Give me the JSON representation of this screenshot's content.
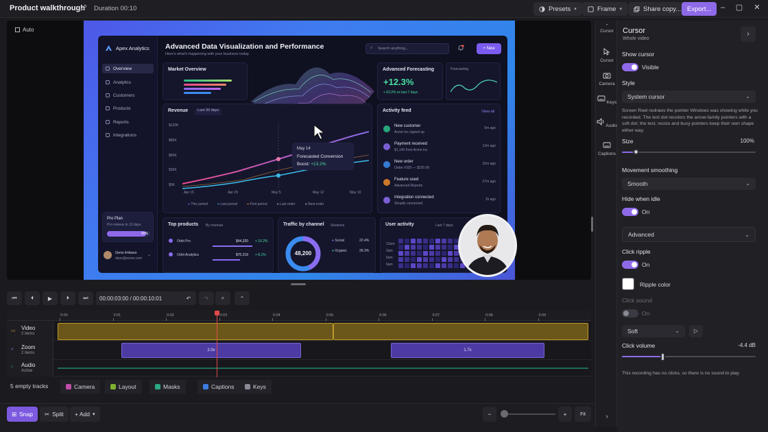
{
  "titlebar": {
    "title": "Product walkthrough",
    "duration": "Duration 00:10",
    "presets": "Presets",
    "frame": "Frame",
    "share": "Share copy...",
    "export": "Export..."
  },
  "preview": {
    "auto_label": "Auto",
    "app": {
      "brand": "Apex Analytics",
      "heading": "Advanced Data Visualization and Performance",
      "subheading": "Here's what's happening with your business today.",
      "search_placeholder": "Search anything...",
      "new_button": "+ New",
      "nav": [
        "Overview",
        "Analytics",
        "Customers",
        "Products",
        "Reports",
        "Integrations"
      ],
      "market_overview": "Market Overview",
      "forecast_title": "Advanced Forecasting",
      "forecast_value": "+12.3%",
      "forecast_sub": "+ 63.2% vs last 7 days",
      "forecasting_label": "Forecasting",
      "revenue_title": "Revenue",
      "revenue_range": "Last 30 days",
      "y_ticks": [
        "$120K",
        "$80K",
        "$60K",
        "$30K",
        "$0K"
      ],
      "x_ticks": [
        "Apr 15",
        "Apr 29",
        "May 5",
        "May 12",
        "May 10"
      ],
      "tooltip_date": "May 14",
      "tooltip_label": "Forecasted Conversion",
      "tooltip_boost_label": "Boost:",
      "tooltip_boost_value": "+13.2%",
      "legend": [
        "This period",
        "Last period",
        "First period",
        "Last order",
        "Next order"
      ],
      "activity_title": "Activity feed",
      "view_all": "View all",
      "activity": [
        {
          "title": "New customer",
          "sub": "Acme Inc signed up",
          "time": "5m ago",
          "color": "#2bbf8a"
        },
        {
          "title": "Payment received",
          "sub": "$1,140 from Acme Inc",
          "time": "12m ago",
          "color": "#8b6cf0"
        },
        {
          "title": "New order",
          "sub": "Order #320 — $220.00",
          "time": "15m ago",
          "color": "#3b8cf0"
        },
        {
          "title": "Feature used",
          "sub": "Advanced Reports",
          "time": "27m ago",
          "color": "#f08a2b"
        },
        {
          "title": "Integration connected",
          "sub": "Shopify connected",
          "time": "1h ago",
          "color": "#8b6cf0"
        }
      ],
      "pro_plan": "Pro Plan",
      "pro_sub": "Pro renews in 13 days",
      "pro_pct": "90%",
      "pro_fill": 0.9,
      "user_name": "Gera Imbaxs",
      "user_email": "dave@acme.com",
      "top_products": "Top products",
      "by_revenue": "By revenue",
      "products": [
        {
          "name": "Orbit Pro",
          "value": "$44,320",
          "delta": "+ 16.2%"
        },
        {
          "name": "Orbit Analytics",
          "value": "$70,219",
          "delta": "+ 8.1%"
        }
      ],
      "traffic_title": "Traffic by channel",
      "traffic_range": "Sessions",
      "traffic_total": "48,200",
      "traffic": [
        {
          "name": "Social",
          "pct": "22.4%"
        },
        {
          "name": "Organic",
          "pct": "28.3%"
        }
      ],
      "user_activity": "User activity",
      "last7": "Last 7 days",
      "heat_rows": [
        "12am",
        "3am",
        "6am",
        "9am"
      ]
    }
  },
  "rail": [
    "Cursor",
    "Camera",
    "Keys",
    "Audio",
    "Captions"
  ],
  "panel": {
    "title": "Cursor",
    "subtitle": "Whole video",
    "show_cursor": "Show cursor",
    "visible": "Visible",
    "style_label": "Style",
    "style_value": "System cursor",
    "description": "Screen Reel redraws the pointer Windows was showing while you recorded. The text dot recolors the arrow-family pointers with a soft dot; the text, resize and busy pointers keep their own shape either way.",
    "size_label": "Size",
    "size_value": "100%",
    "size_level": 0.1,
    "smoothing_label": "Movement smoothing",
    "smoothing_value": "Smooth",
    "hide_idle": "Hide when idle",
    "on": "On",
    "advanced": "Advanced",
    "click_ripple": "Click ripple",
    "ripple_color": "Ripple color",
    "click_sound": "Click sound",
    "sound_type": "Soft",
    "click_volume": "Click volume",
    "volume_value": "-4.4 dB",
    "volume_level": 0.3,
    "footer": "This recording has no clicks, so there is no sound to play."
  },
  "transport": {
    "timecode": "00:00:03:00 / 00:00:10:01"
  },
  "ruler": [
    "0:00",
    "0:01",
    "0:02",
    "0:03",
    "0:04",
    "0:05",
    "0:06",
    "0:07",
    "0:08",
    "0:09"
  ],
  "tracks": [
    {
      "name": "Video",
      "sub": "2 items"
    },
    {
      "name": "Zoom",
      "sub": "2 items"
    },
    {
      "name": "Audio",
      "sub": "Active"
    }
  ],
  "zoom_segments": [
    "2.0x",
    "1.7x"
  ],
  "empty_tracks": {
    "label": "5 empty tracks",
    "items": [
      {
        "name": "Camera",
        "color": "#c04ea8"
      },
      {
        "name": "Layout",
        "color": "#7fb12e"
      },
      {
        "name": "Masks",
        "color": "#2ea884"
      },
      {
        "name": "Captions",
        "color": "#3c7be0"
      },
      {
        "name": "Keys",
        "color": "#8a8a96"
      }
    ]
  },
  "bottombar": {
    "snap": "Snap",
    "split": "Split",
    "add": "+ Add",
    "fit": "Fit"
  },
  "colors": {
    "accent": "#8f6ae8",
    "video_track": "#c09a2e",
    "zoom_track": "#7663d4",
    "playhead": "#e24a4a"
  }
}
